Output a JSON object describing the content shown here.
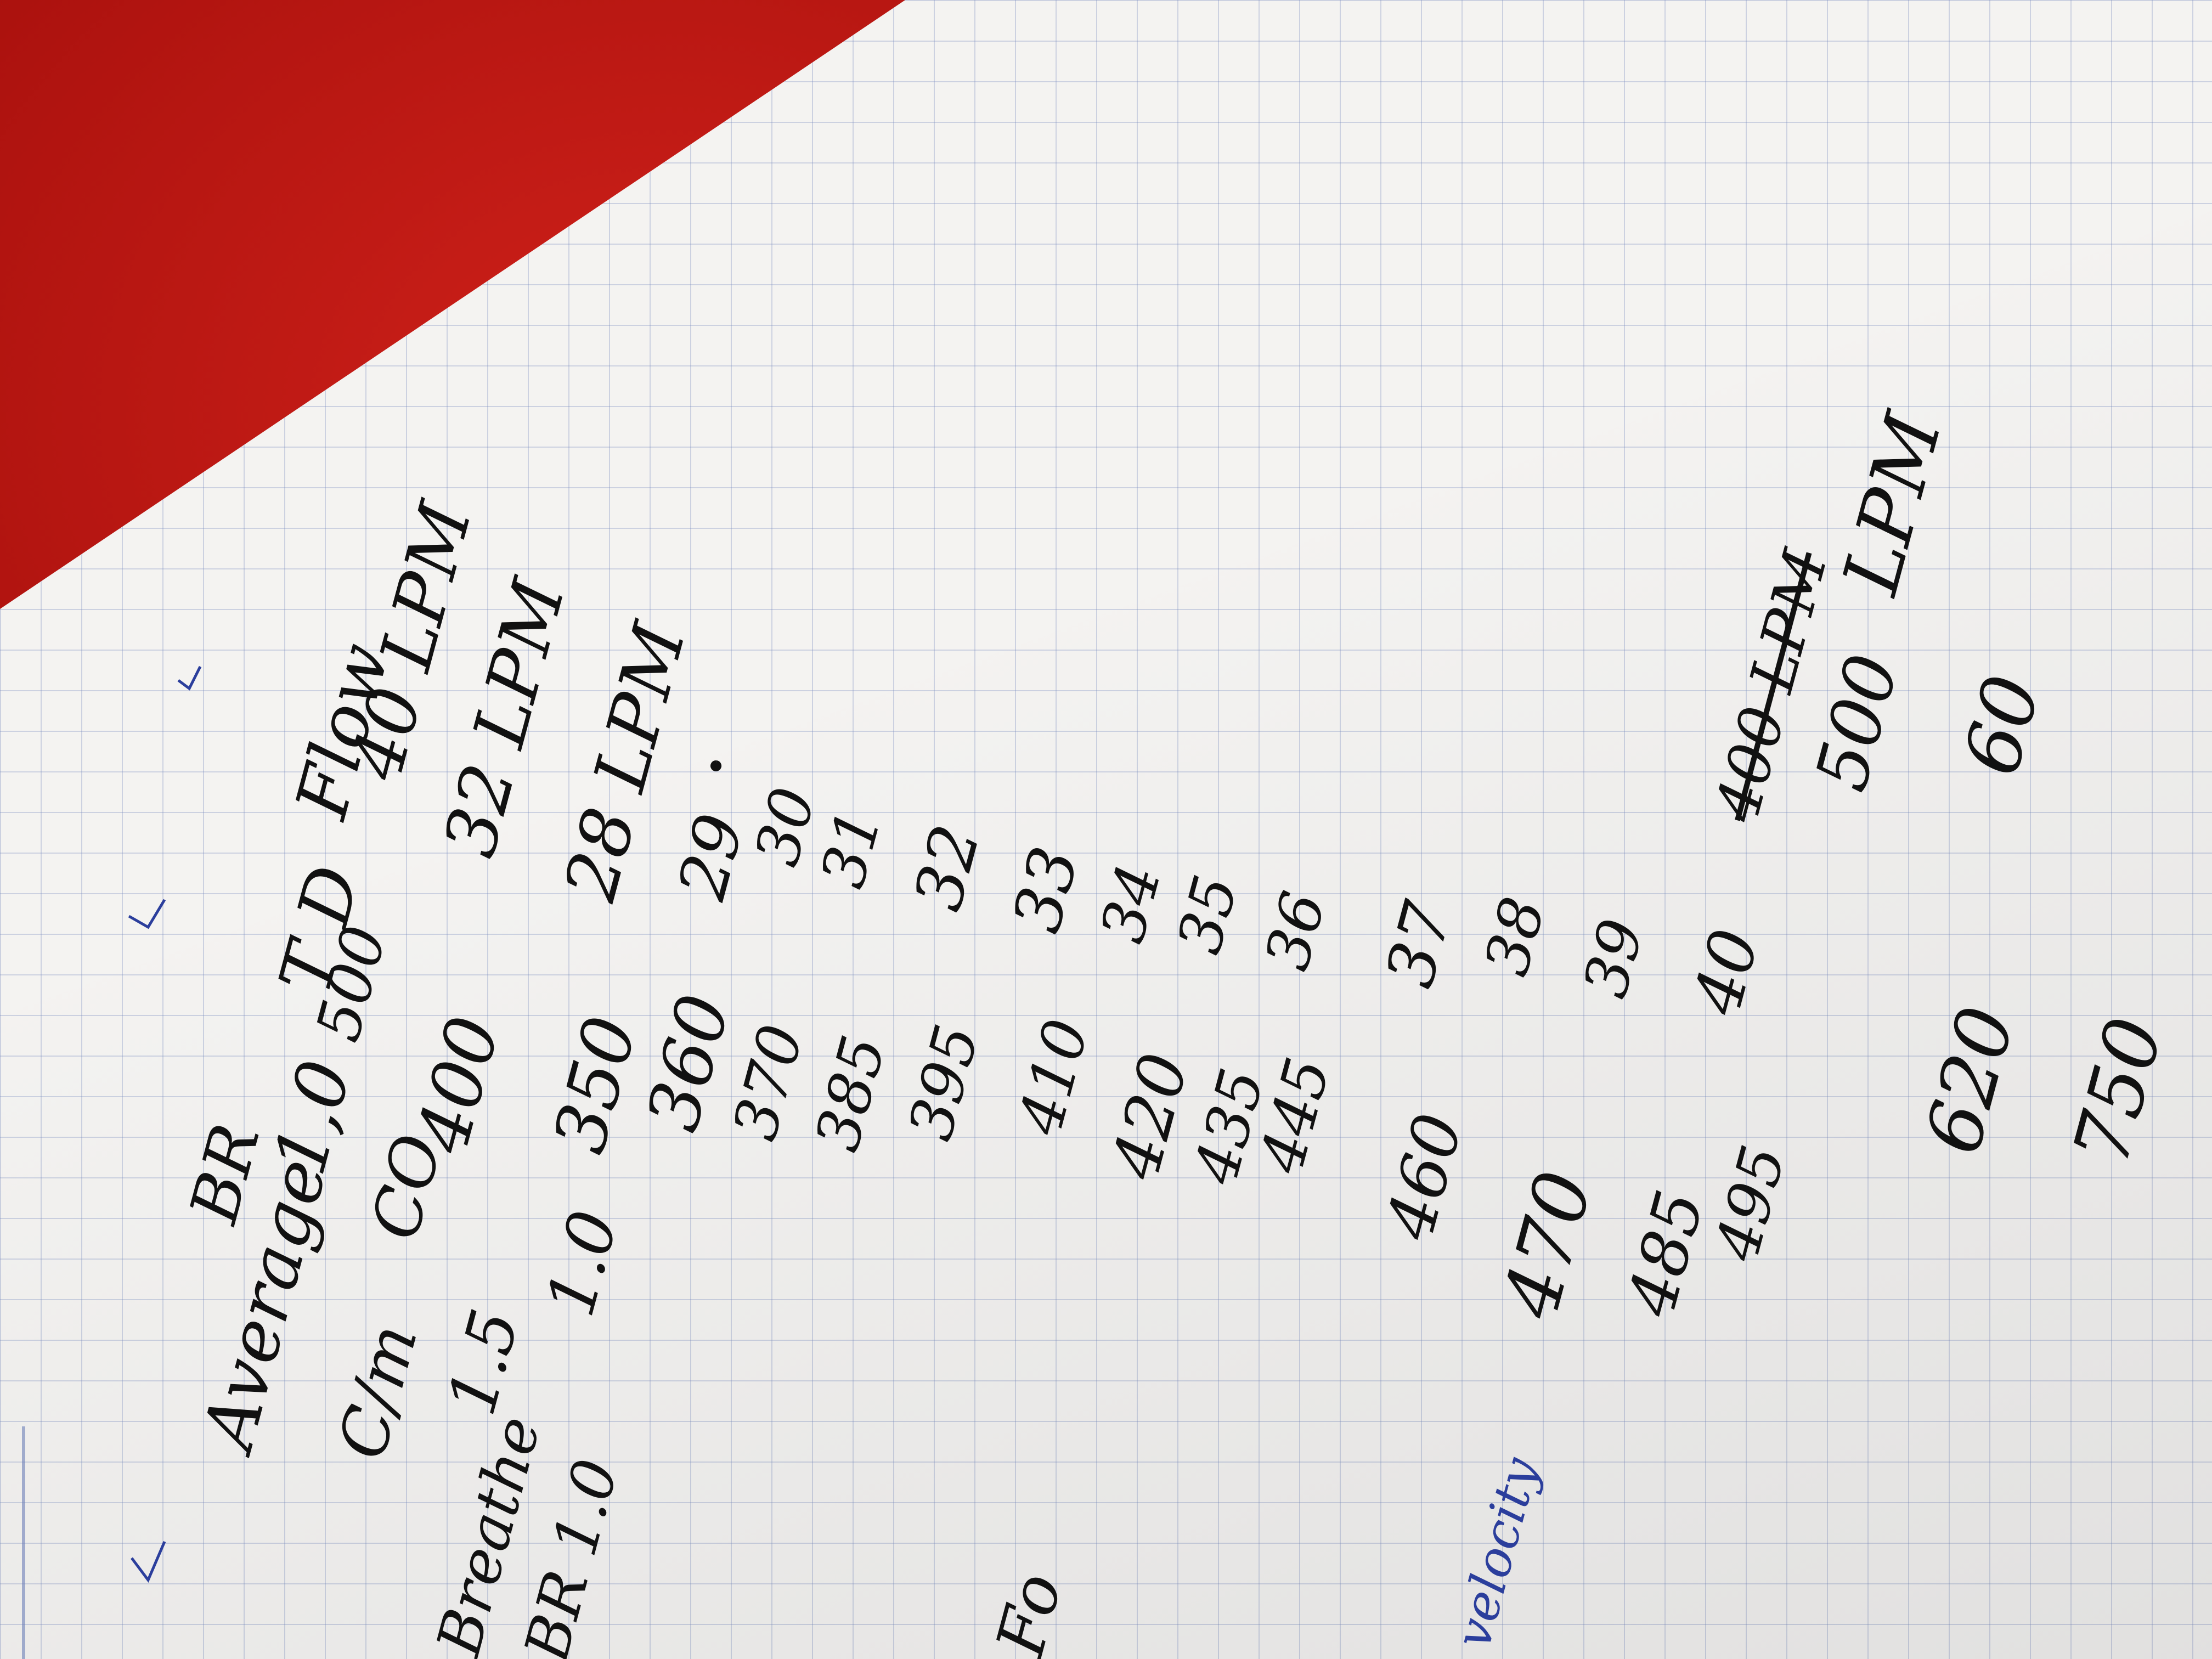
{
  "header": {
    "br": "BR",
    "average": "Average",
    "id": "1,0",
    "td": "T D",
    "flow": "Flow"
  },
  "rows": [
    {
      "label": "C/m",
      "c1": "1.5",
      "c2": "CO",
      "c3": "500",
      "c4": "40 LPM"
    },
    {
      "label": "Breathe",
      "c1": "1.0",
      "c2": "400",
      "c3": "",
      "c4": "32 LPM"
    },
    {
      "label": "BR 1.0",
      "c1": "",
      "c2": "350",
      "c3": "",
      "c4": "28 LPM"
    }
  ],
  "volumes": [
    "360",
    "370",
    "385",
    "395",
    "410",
    "420",
    "435",
    "445",
    "460",
    "470",
    "485",
    "495",
    "620",
    "750"
  ],
  "flows": [
    "29",
    "30",
    "31",
    "32",
    "33",
    "34",
    "35",
    "36",
    "37",
    "38",
    "39",
    "40"
  ],
  "extra": {
    "struck": "400 LPM",
    "v500": "500",
    "v60": "60",
    "lpm": "LPM"
  },
  "margin_notes": {
    "velocity": "velocity",
    "left_mark": "Fo"
  }
}
